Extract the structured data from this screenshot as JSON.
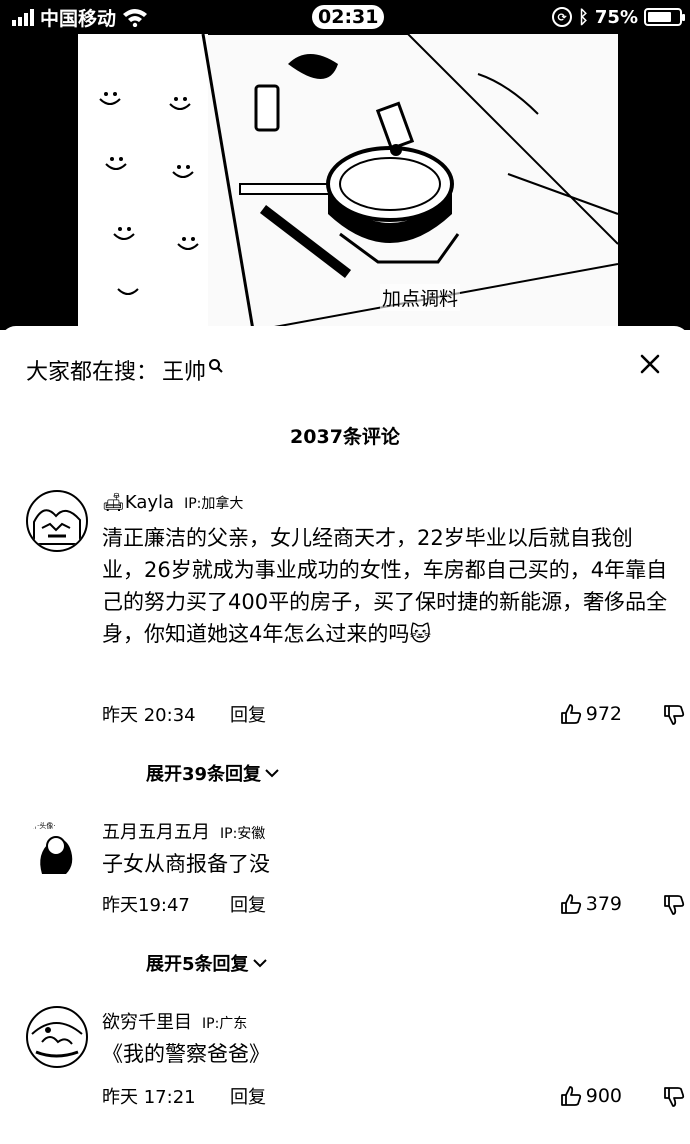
{
  "status_bar": {
    "carrier": "中国移动",
    "time": "02:31",
    "battery": "75%",
    "battery_level": 0.75
  },
  "video": {
    "caption": "加点调料"
  },
  "search": {
    "label": "大家都在搜：",
    "term": "王帅"
  },
  "comments_header": {
    "count_text": "2037条评论"
  },
  "comments": [
    {
      "user": "Kayla",
      "ip": "IP:加拿大",
      "text": "清正廉洁的父亲，女儿经商天才，22岁毕业以后就自我创业，26岁就成为事业成功的女性，车房都自己买的，4年靠自己的努力买了400平的房子，买了保时捷的新能源，奢侈品全身，你知道她这4年怎么过来的吗",
      "time": "昨天 20:34",
      "reply": "回复",
      "likes": "972",
      "expand": "展开39条回复"
    },
    {
      "user": "五月五月五月",
      "ip": "IP:安徽",
      "text": "子女从商报备了没",
      "time": "昨天19:47",
      "reply": "回复",
      "likes": "379",
      "expand": "展开5条回复"
    },
    {
      "user": "欲穷千里目",
      "ip": "IP:广东",
      "text": "《我的警察爸爸》",
      "time": "昨天 17:21",
      "reply": "回复",
      "likes": "900"
    }
  ]
}
